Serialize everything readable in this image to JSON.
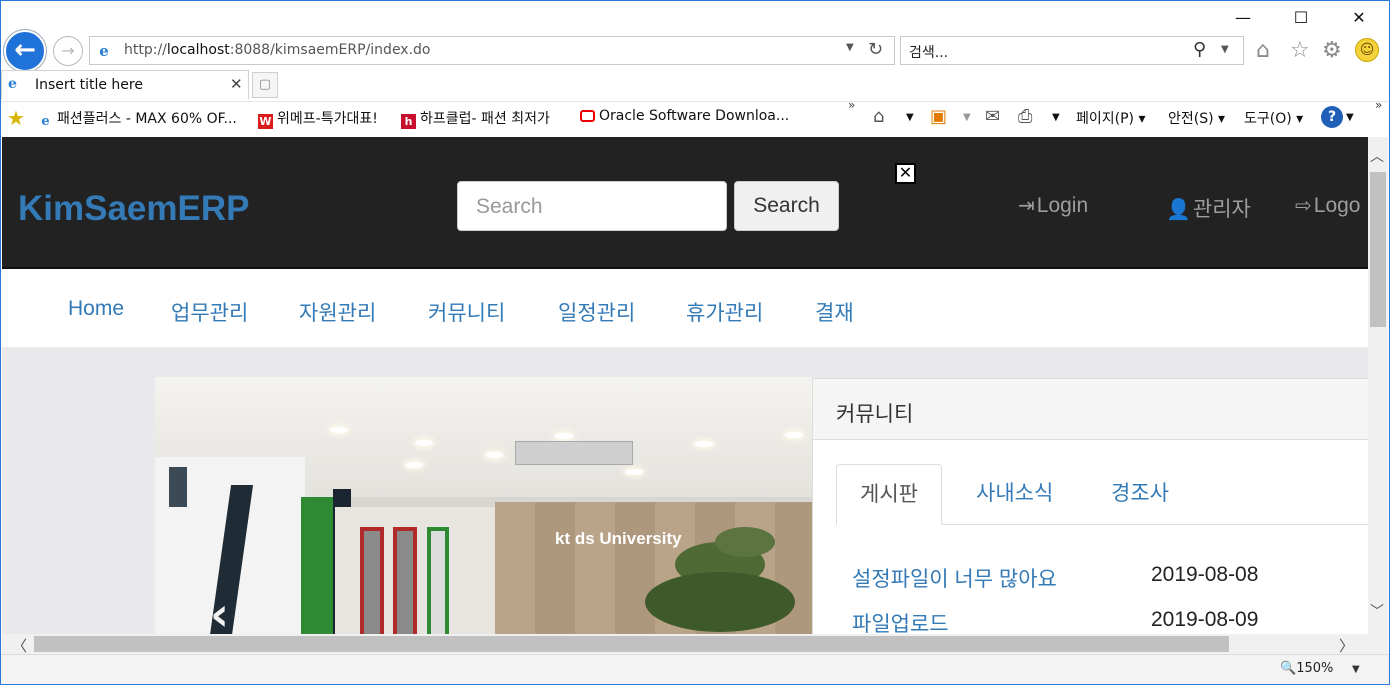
{
  "browser": {
    "address": "http://localhost:8088/kimsaemERP/index.do",
    "address_host": "localhost",
    "address_prefix": "http://",
    "address_rest": ":8088/kimsaemERP/index.do",
    "search_placeholder": "검색...",
    "tab_title": "Insert title here",
    "favorites": [
      {
        "label": "패션플러스 - MAX 60% OF...",
        "icon": "ie-page-icon"
      },
      {
        "label": "위메프-특가대표!",
        "icon": "wemakeprice-icon"
      },
      {
        "label": "하프클럽- 패션 최저가",
        "icon": "halfclub-icon"
      },
      {
        "label": "Oracle Software Downloa...",
        "icon": "oracle-icon"
      }
    ],
    "commands": {
      "page": "페이지(P)",
      "safety": "안전(S)",
      "tools": "도구(O)"
    },
    "zoom": "150%"
  },
  "site": {
    "brand": "KimSaemERP",
    "search_placeholder": "Search",
    "search_button": "Search",
    "header_links": {
      "login": "Login",
      "admin": "관리자",
      "logout": "Logo"
    },
    "nav": [
      "Home",
      "업무관리",
      "자원관리",
      "커뮤니티",
      "일정관리",
      "휴가관리",
      "결재"
    ]
  },
  "carousel": {
    "sign_text": "kt ds  University",
    "prev_glyph": "‹"
  },
  "community": {
    "title": "커뮤니티",
    "tabs": [
      "게시판",
      "사내소식",
      "경조사"
    ],
    "posts": [
      {
        "title": "설정파일이 너무 많아요",
        "date": "2019-08-08"
      },
      {
        "title": "파일업로드",
        "date": "2019-08-09"
      }
    ]
  },
  "colors": {
    "link": "#337ab7",
    "header_bg": "#222222",
    "ie_blue": "#1e72d8"
  }
}
